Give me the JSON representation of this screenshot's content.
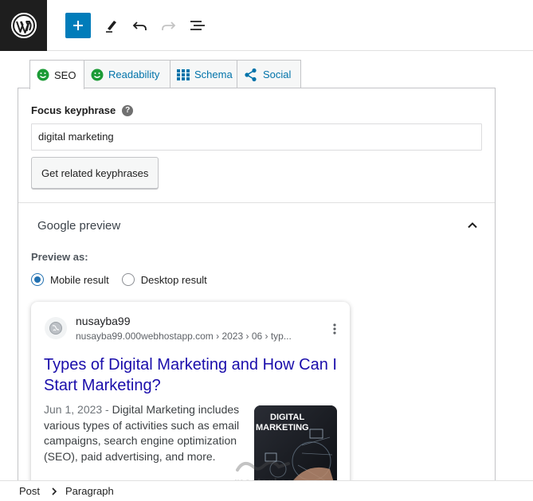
{
  "toolbar": {
    "logo_icon": "wordpress-logo-icon",
    "add_icon": "plus-icon",
    "tools_icon": "pencil-icon",
    "undo_icon": "undo-icon",
    "redo_icon": "redo-icon",
    "outline_icon": "list-view-icon"
  },
  "tabs": [
    {
      "label": "SEO",
      "icon": "smiley-green-icon",
      "active": true
    },
    {
      "label": "Readability",
      "icon": "smiley-green-icon",
      "active": false
    },
    {
      "label": "Schema",
      "icon": "grid-icon",
      "active": false
    },
    {
      "label": "Social",
      "icon": "share-icon",
      "active": false
    }
  ],
  "focus": {
    "label": "Focus keyphrase",
    "help_glyph": "?",
    "value": "digital marketing",
    "related_button": "Get related keyphrases"
  },
  "google_preview": {
    "title": "Google preview",
    "preview_as": "Preview as:",
    "options": [
      "Mobile result",
      "Desktop result"
    ],
    "selected": "Mobile result"
  },
  "serp": {
    "site_name": "nusayba99",
    "url": "nusayba99.000webhostapp.com › 2023 › 06 › typ...",
    "title": "Types of Digital Marketing and How Can I Start Marketing?",
    "date": "Jun 1, 2023",
    "date_sep": " - ",
    "description": "Digital Marketing includes various types of activities such as email campaigns, search engine optimization (SEO), paid advertising, and more.",
    "thumb_text": [
      "DIGITAL",
      "MARKETING"
    ]
  },
  "breadcrumb": {
    "root": "Post",
    "current": "Paragraph"
  },
  "watermark": {
    "text": "mostaql.com"
  },
  "colors": {
    "accent": "#007cba",
    "link": "#1a0dab",
    "smiley": "#1c9b36",
    "tab_link": "#0073aa"
  }
}
